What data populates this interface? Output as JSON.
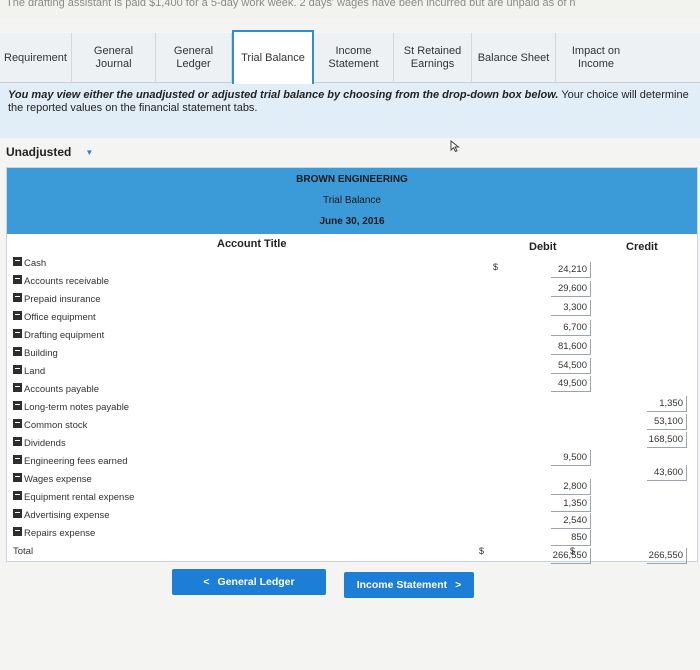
{
  "header_strip": "The drafting assistant is paid $1,400 for a 5-day work week. 2 days' wages have been incurred but are unpaid as of n",
  "tabs": [
    {
      "label": "Requirement"
    },
    {
      "label": "General\nJournal"
    },
    {
      "label": "General\nLedger"
    },
    {
      "label": "Trial Balance"
    },
    {
      "label": "Income\nStatement"
    },
    {
      "label": "St Retained\nEarnings"
    },
    {
      "label": "Balance Sheet"
    },
    {
      "label": "Impact on\nIncome"
    }
  ],
  "instructions": {
    "bold": "You may view either the unadjusted or adjusted trial balance by choosing from the drop-down box below.",
    "rest": " Your choice will determine the reported values on the financial statement tabs."
  },
  "dropdown": {
    "selected": "Unadjusted"
  },
  "sheet": {
    "company": "BROWN ENGINEERING",
    "title": "Trial Balance",
    "date": "June 30, 2016",
    "col_account": "Account Title",
    "col_debit": "Debit",
    "col_credit": "Credit",
    "dollar": "$",
    "rows": [
      {
        "account": "Cash",
        "debit": "24,210",
        "credit": ""
      },
      {
        "account": "Accounts receivable",
        "debit": "29,600",
        "credit": ""
      },
      {
        "account": "Prepaid insurance",
        "debit": "3,300",
        "credit": ""
      },
      {
        "account": "Office equipment",
        "debit": "6,700",
        "credit": ""
      },
      {
        "account": "Drafting equipment",
        "debit": "81,600",
        "credit": ""
      },
      {
        "account": "Building",
        "debit": "54,500",
        "credit": ""
      },
      {
        "account": "Land",
        "debit": "49,500",
        "credit": ""
      },
      {
        "account": "Accounts payable",
        "debit": "",
        "credit": "1,350"
      },
      {
        "account": "Long-term notes payable",
        "debit": "",
        "credit": "53,100"
      },
      {
        "account": "Common stock",
        "debit": "",
        "credit": "168,500"
      },
      {
        "account": "Dividends",
        "debit": "9,500",
        "credit": ""
      },
      {
        "account": "Engineering fees earned",
        "debit": "",
        "credit": "43,600"
      },
      {
        "account": "Wages expense",
        "debit": "2,800",
        "credit": ""
      },
      {
        "account": "Equipment rental expense",
        "debit": "1,350",
        "credit": ""
      },
      {
        "account": "Advertising expense",
        "debit": "2,540",
        "credit": ""
      },
      {
        "account": "Repairs expense",
        "debit": "850",
        "credit": ""
      },
      {
        "account": "Total",
        "debit": "266,550",
        "credit": "266,550"
      }
    ]
  },
  "nav": {
    "prev_label": "General Ledger",
    "prev_arrow": "<",
    "next_label": "Income Statement",
    "next_arrow": ">"
  }
}
